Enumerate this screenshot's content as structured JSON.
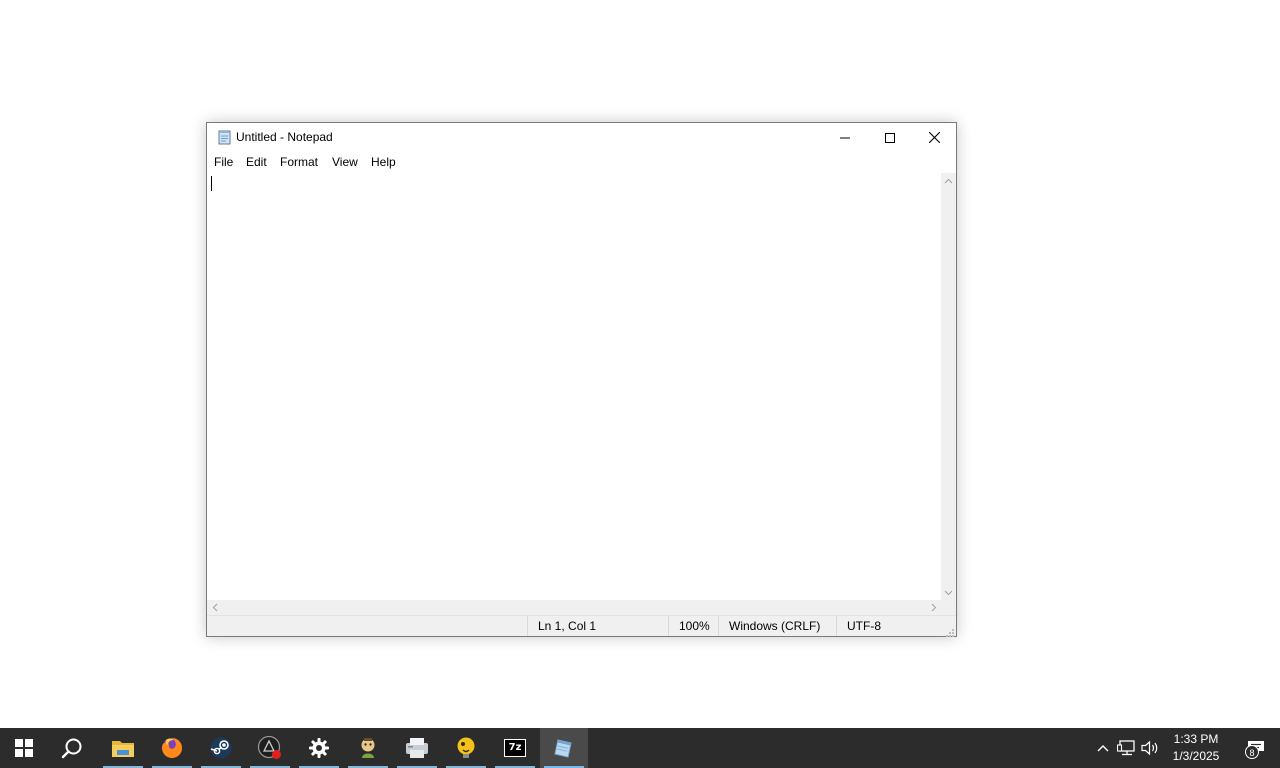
{
  "window": {
    "title": "Untitled - Notepad",
    "app_icon": "notepad-icon",
    "controls": [
      "minimize-icon",
      "maximize-icon",
      "close-icon"
    ]
  },
  "menubar": {
    "items": [
      {
        "label": "File"
      },
      {
        "label": "Edit"
      },
      {
        "label": "Format"
      },
      {
        "label": "View"
      },
      {
        "label": "Help"
      }
    ]
  },
  "editor": {
    "content": ""
  },
  "statusbar": {
    "position": "Ln 1, Col 1",
    "zoom": "100%",
    "line_ending": "Windows (CRLF)",
    "encoding": "UTF-8"
  },
  "taskbar": {
    "pinned": [
      {
        "name": "start",
        "icon": "windows-start-icon"
      },
      {
        "name": "search",
        "icon": "search-icon"
      },
      {
        "name": "file-explorer",
        "icon": "folder-icon"
      },
      {
        "name": "firefox",
        "icon": "firefox-icon"
      },
      {
        "name": "steam",
        "icon": "steam-icon"
      },
      {
        "name": "app-dark",
        "icon": "dark-app-icon"
      },
      {
        "name": "settings",
        "icon": "gear-icon"
      },
      {
        "name": "app-character",
        "icon": "character-icon"
      },
      {
        "name": "app-printer",
        "icon": "printer-icon"
      },
      {
        "name": "app-bulb",
        "icon": "lightbulb-icon"
      },
      {
        "name": "7zip",
        "icon": "7zip-icon",
        "label": "7z"
      },
      {
        "name": "notepad",
        "icon": "notepad-icon"
      }
    ],
    "tray": {
      "icons": [
        "chevron-up-icon",
        "network-icon",
        "volume-icon"
      ],
      "time": "1:33 PM",
      "date": "1/3/2025",
      "notifications_count": "8"
    }
  },
  "colors": {
    "taskbar": "#2c2c2c",
    "accent": "#76b9ed",
    "window_bg": "#ffffff",
    "statusbar": "#f0f0f0"
  }
}
